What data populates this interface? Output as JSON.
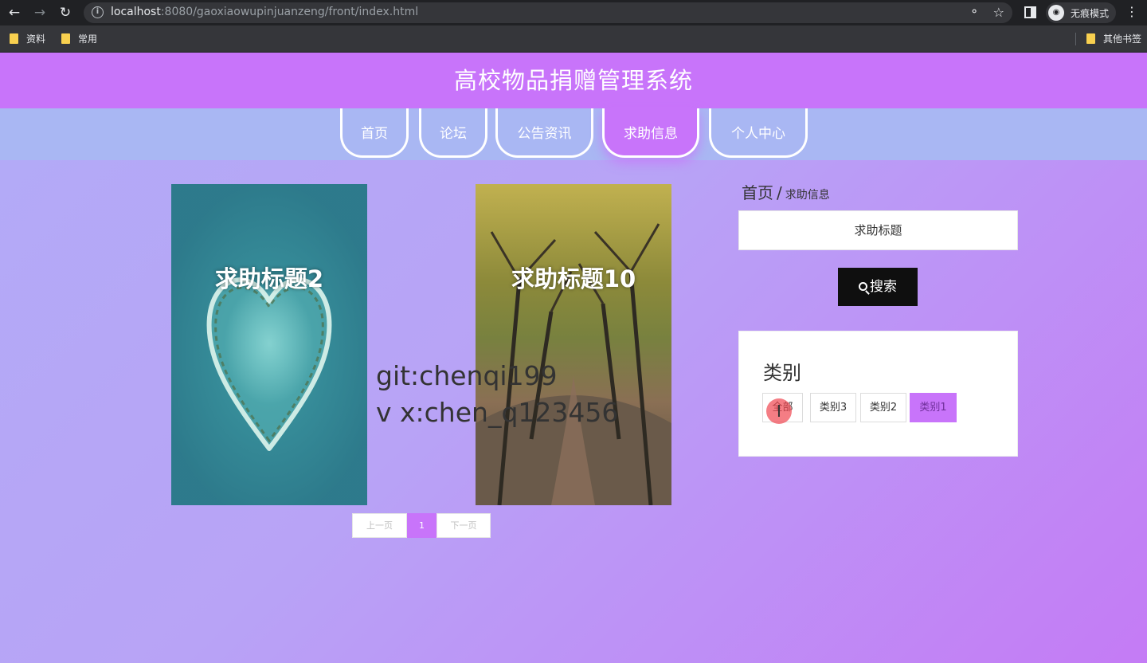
{
  "browser": {
    "url_host": "localhost",
    "url_rest": ":8080/gaoxiaowupinjuanzeng/front/index.html",
    "incognito_label": "无痕模式",
    "bookmarks": [
      "资料",
      "常用"
    ],
    "other_bookmarks": "其他书签"
  },
  "site": {
    "title": "高校物品捐赠管理系统",
    "nav": [
      "首页",
      "论坛",
      "公告资讯",
      "求助信息",
      "个人中心"
    ],
    "active_nav": "求助信息"
  },
  "cards": [
    {
      "title": "求助标题2"
    },
    {
      "title": "求助标题10"
    }
  ],
  "watermark": {
    "line1": "git:chenqi199",
    "line2": "v x:chen_q123456"
  },
  "pagination": {
    "prev": "上一页",
    "current": "1",
    "next": "下一页"
  },
  "breadcrumb": {
    "home": "首页",
    "separator": "/",
    "current": "求助信息"
  },
  "search": {
    "placeholder": "求助标题",
    "button": "搜索"
  },
  "category": {
    "title": "类别",
    "options": [
      "全部",
      "类别3",
      "类别2",
      "类别1"
    ],
    "active": "类别1"
  },
  "cursor_marker": "I",
  "colors": {
    "header": "#c874fa",
    "nav_strip": "#a9b7f3",
    "active": "#c874fa",
    "search_button": "#0f0f0f"
  }
}
